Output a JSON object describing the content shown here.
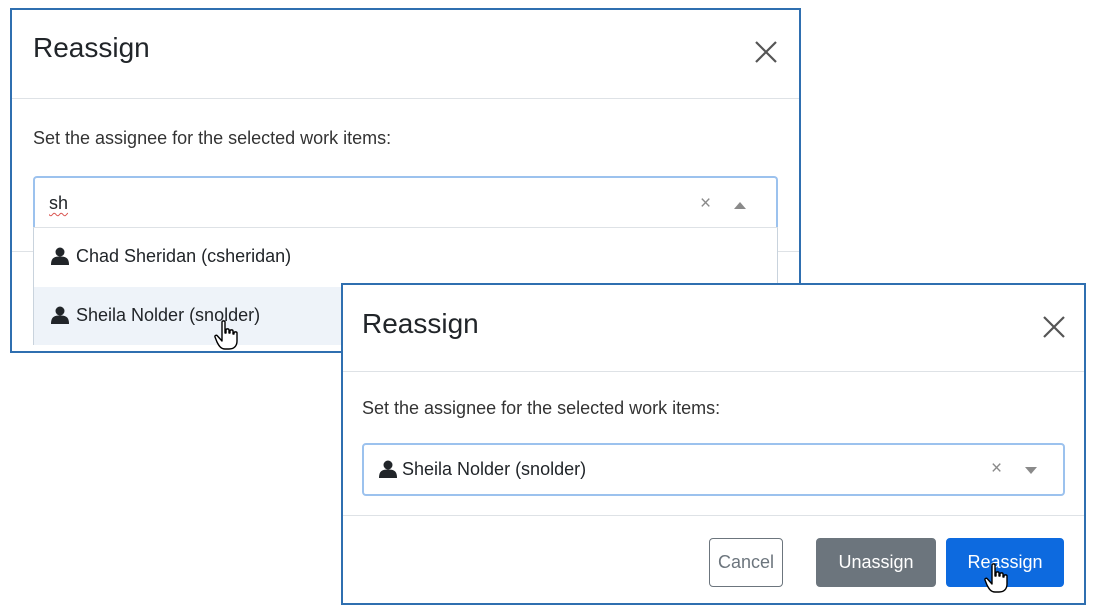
{
  "dialog1": {
    "title": "Reassign",
    "description": "Set the assignee for the selected work items:",
    "search_value": "sh",
    "options": [
      {
        "label": "Chad Sheridan (csheridan)"
      },
      {
        "label": "Sheila Nolder (snolder)"
      }
    ],
    "hovered_option_index": 1
  },
  "dialog2": {
    "title": "Reassign",
    "description": "Set the assignee for the selected work items:",
    "selected_value": "Sheila Nolder (snolder)",
    "buttons": {
      "cancel": "Cancel",
      "unassign": "Unassign",
      "reassign": "Reassign"
    }
  },
  "icons": {
    "close": "close-icon",
    "clear": "clear-icon",
    "caret_up": "caret-up-icon",
    "caret_down": "caret-down-icon",
    "person": "person-icon",
    "hand_cursor": "hand-pointer-icon"
  },
  "colors": {
    "dialog_border": "#2f6fb0",
    "focus_border": "#9cc2ee",
    "primary": "#0d6adf",
    "secondary": "#6c757d",
    "hover_bg": "#eef3f9"
  }
}
